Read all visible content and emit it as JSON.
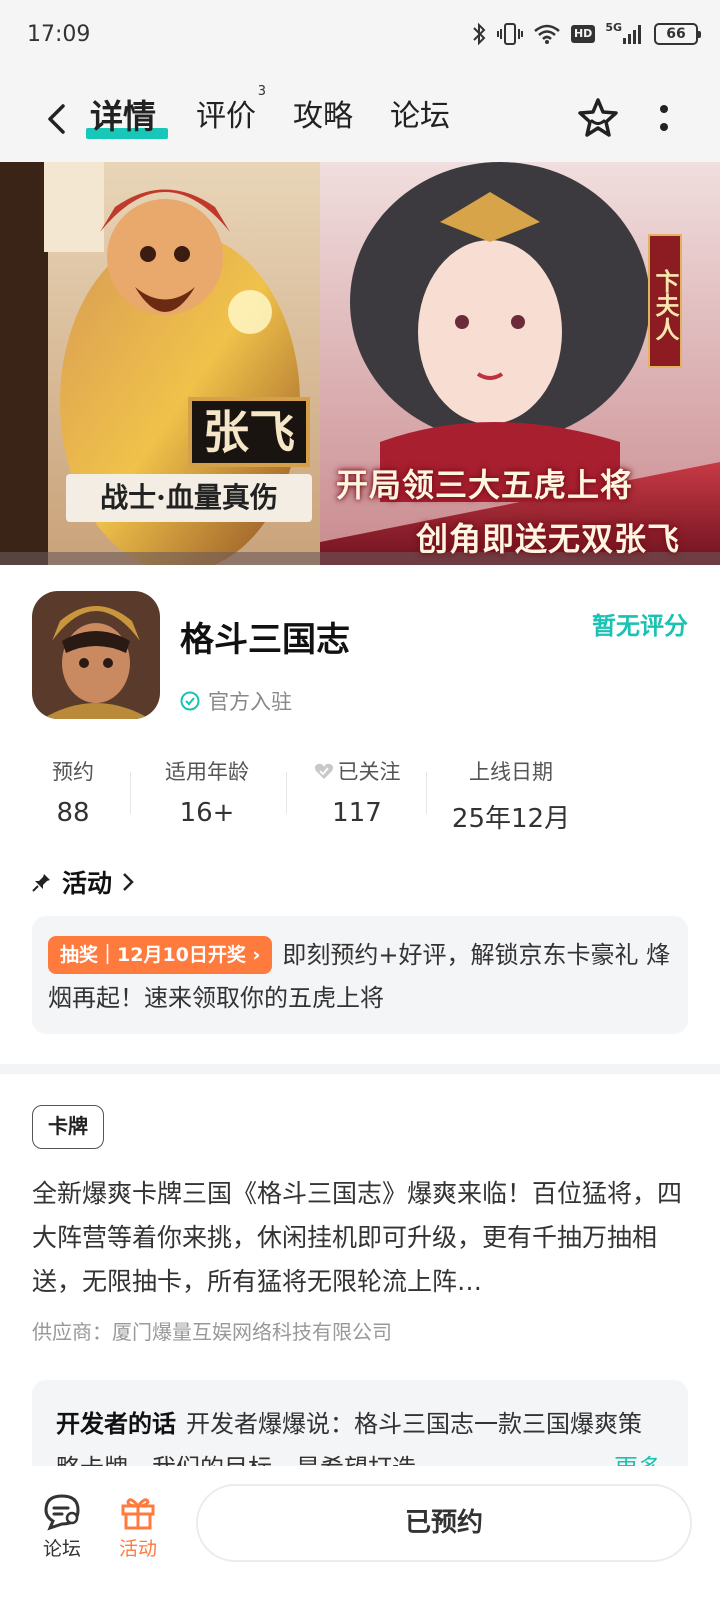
{
  "status_bar": {
    "time": "17:09",
    "network": "5G",
    "hd": "HD",
    "battery": "66"
  },
  "nav": {
    "tabs": [
      {
        "label": "详情",
        "active": true
      },
      {
        "label": "评价",
        "badge": "3"
      },
      {
        "label": "攻略"
      },
      {
        "label": "论坛"
      }
    ],
    "icons": {
      "back": "back-arrow-icon",
      "favorite": "star-icon",
      "more": "more-vertical-icon"
    }
  },
  "banner": {
    "hero_name": "张飞",
    "hero_class": "战士·血量真伤",
    "slogan_line1": "开局领三大五虎上将",
    "slogan_line2": "创角即送无双张飞",
    "vertical_label": "卞夫人"
  },
  "app": {
    "name": "格斗三国志",
    "official_label": "官方入驻",
    "rating_label": "暂无评分"
  },
  "stats": [
    {
      "label": "预约",
      "value": "88"
    },
    {
      "label": "适用年龄",
      "value": "16+"
    },
    {
      "label": "已关注",
      "value": "117"
    },
    {
      "label": "上线日期",
      "value": "25年12月"
    }
  ],
  "activity": {
    "heading": "活动",
    "tag": "抽奖｜12月10日开奖",
    "text": "即刻预约+好评，解锁京东卡豪礼 烽烟再起！速来领取你的五虎上将"
  },
  "description": {
    "tag": "卡牌",
    "text": "全新爆爽卡牌三国《格斗三国志》爆爽来临！百位猛将，四大阵营等着你来挑，休闲挂机即可升级，更有千抽万抽相送，无限抽卡，所有猛将无限轮流上阵…",
    "supplier": "供应商：厦门爆量互娱网络科技有限公司"
  },
  "developer_note": {
    "title": "开发者的话",
    "text": "开发者爆爆说：格斗三国志一款三国爆爽策略卡牌，我们的目标，是希望打造",
    "more": "更多"
  },
  "bottom_bar": {
    "forum_label": "论坛",
    "activity_label": "活动",
    "reserve_label": "已预约",
    "colors": {
      "accent": "#ff7a3d",
      "teal": "#19c2b2"
    }
  }
}
